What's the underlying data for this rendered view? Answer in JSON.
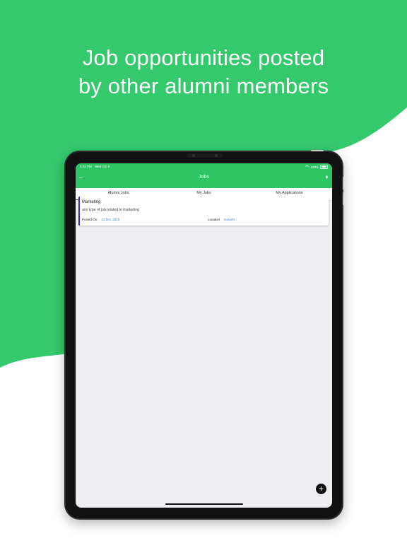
{
  "headline": {
    "line1": "Job opportunities posted",
    "line2": "by other alumni members"
  },
  "colors": {
    "brand_green": "#2ec564",
    "card_accent": "#3b2ec5",
    "link_blue": "#3a79d8"
  },
  "status_bar": {
    "time": "5:43 PM",
    "date": "Wed Oct 2",
    "battery": "100%"
  },
  "nav": {
    "title": "Jobs",
    "back_icon": "arrow-left-icon",
    "right_icon": "bell-icon"
  },
  "tabs": [
    {
      "label": "Alumni Jobs",
      "active": true
    },
    {
      "label": "My Jobs",
      "active": false
    },
    {
      "label": "My Applications",
      "active": false
    }
  ],
  "jobs": [
    {
      "title": "Marketing",
      "description": "any type of job related to marketing",
      "posted_label": "Posted On",
      "posted_value": "01 Oct, 2019",
      "location_label": "Location",
      "location_value": "Karachi"
    }
  ],
  "fab": {
    "icon": "plus-icon",
    "label": "+"
  }
}
